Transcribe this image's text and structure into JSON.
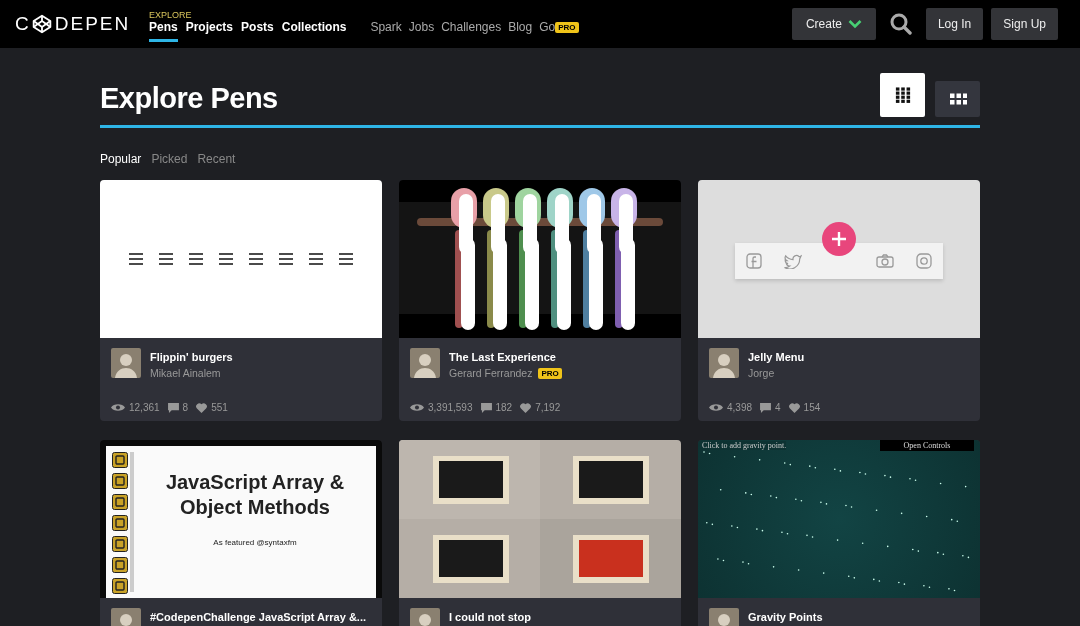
{
  "header": {
    "logo": {
      "before": "C",
      "after": "DEPEN"
    },
    "section_label": "EXPLORE",
    "primary_nav": [
      {
        "label": "Pens",
        "selected": true
      },
      {
        "label": "Projects",
        "selected": false
      },
      {
        "label": "Posts",
        "selected": false
      },
      {
        "label": "Collections",
        "selected": false
      }
    ],
    "secondary_nav": [
      {
        "label": "Spark"
      },
      {
        "label": "Jobs"
      },
      {
        "label": "Challenges"
      },
      {
        "label": "Blog"
      },
      {
        "label": "Go",
        "badge": "PRO"
      }
    ],
    "create_button": "Create",
    "login_button": "Log In",
    "signup_button": "Sign Up"
  },
  "page_title": "Explore Pens",
  "view_toggles": [
    {
      "kind": "dense",
      "selected": true
    },
    {
      "kind": "large",
      "selected": false
    }
  ],
  "tabs": [
    {
      "label": "Popular",
      "selected": true
    },
    {
      "label": "Picked",
      "selected": false
    },
    {
      "label": "Recent",
      "selected": false
    }
  ],
  "pens": [
    {
      "title": "Flippin' burgers",
      "author": "Mikael Ainalem",
      "views": "12,361",
      "comments": "8",
      "likes": "551",
      "preview": {
        "kind": "hamburgers"
      }
    },
    {
      "title": "The Last Experience",
      "author": "Gerard Ferrandez",
      "author_badge": "PRO",
      "views": "3,391,593",
      "comments": "182",
      "likes": "7,192",
      "preview": {
        "kind": "arms"
      }
    },
    {
      "title": "Jelly Menu",
      "author": "Jorge",
      "views": "4,398",
      "comments": "4",
      "likes": "154",
      "preview": {
        "kind": "jelly"
      }
    },
    {
      "title": "#CodepenChallenge JavaScript Array &...",
      "preview": {
        "kind": "slide",
        "heading": "JavaScript Array & Object Methods",
        "caption": "As featured @syntaxfm"
      }
    },
    {
      "title": "I could not stop"
    },
    {
      "title": "Gravity Points",
      "preview": {
        "kind": "gravity",
        "hint": "Click to add gravity point.",
        "controls": "Open Controls"
      }
    }
  ]
}
